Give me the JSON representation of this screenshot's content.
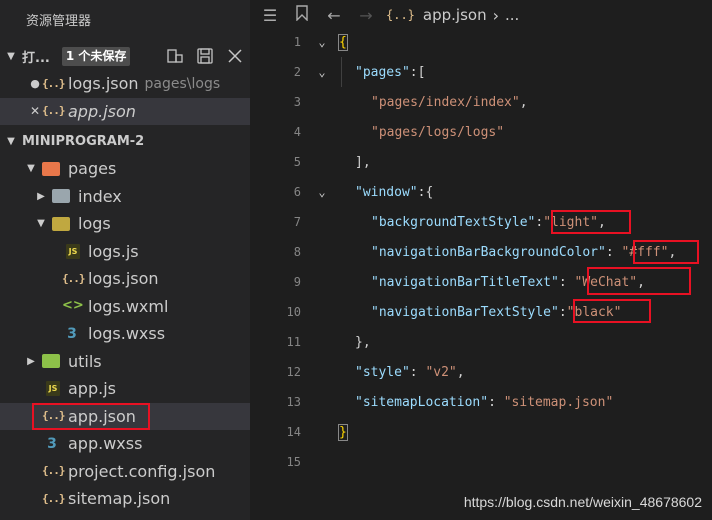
{
  "sidebar": {
    "title": "资源管理器",
    "open_editors": {
      "label": "打...",
      "badge": "1 个未保存",
      "files": [
        {
          "marker": "●",
          "name": "logs.json",
          "path": "pages\\logs",
          "icon": "json-icon"
        },
        {
          "marker": "✕",
          "name": "app.json",
          "path": "",
          "icon": "json-icon"
        }
      ]
    },
    "project": {
      "label": "MINIPROGRAM-2",
      "tree": [
        {
          "name": "pages",
          "type": "folder",
          "icon": "pages-folder-icon"
        },
        {
          "name": "index",
          "type": "folder",
          "icon": "folder-icon"
        },
        {
          "name": "logs",
          "type": "folder",
          "icon": "folder-icon"
        },
        {
          "name": "logs.js",
          "type": "js",
          "icon": "js-file-icon"
        },
        {
          "name": "logs.json",
          "type": "json",
          "icon": "json-icon"
        },
        {
          "name": "logs.wxml",
          "type": "wxml",
          "icon": "wxml-file-icon"
        },
        {
          "name": "logs.wxss",
          "type": "wxss",
          "icon": "wxss-file-icon"
        },
        {
          "name": "utils",
          "type": "folder",
          "icon": "utils-folder-icon"
        },
        {
          "name": "app.js",
          "type": "js",
          "icon": "js-file-icon"
        },
        {
          "name": "app.json",
          "type": "json",
          "icon": "json-icon"
        },
        {
          "name": "app.wxss",
          "type": "wxss",
          "icon": "wxss-file-icon"
        },
        {
          "name": "project.config.json",
          "type": "json",
          "icon": "json-icon"
        },
        {
          "name": "sitemap.json",
          "type": "json",
          "icon": "json-icon"
        }
      ]
    }
  },
  "editor": {
    "breadcrumb": {
      "icon": "{..}",
      "file": "app.json",
      "sep": "›",
      "more": "..."
    },
    "lines": [
      {
        "num": "1",
        "text": "{"
      },
      {
        "num": "2",
        "key": "\"pages\"",
        "rest": ":["
      },
      {
        "num": "3",
        "str": "\"pages/index/index\"",
        "rest": ","
      },
      {
        "num": "4",
        "str": "\"pages/logs/logs\"",
        "rest": ""
      },
      {
        "num": "5",
        "text": "],"
      },
      {
        "num": "6",
        "key": "\"window\"",
        "rest": ":{"
      },
      {
        "num": "7",
        "key": "\"backgroundTextStyle\"",
        "colon": ":",
        "val": "\"light\"",
        "rest": ","
      },
      {
        "num": "8",
        "key": "\"navigationBarBackgroundColor\"",
        "colon": ": ",
        "val": "\"#fff\"",
        "rest": ","
      },
      {
        "num": "9",
        "key": "\"navigationBarTitleText\"",
        "colon": ": ",
        "val": "\"WeChat\"",
        "rest": ","
      },
      {
        "num": "10",
        "key": "\"navigationBarTextStyle\"",
        "colon": ":",
        "val": "\"black\"",
        "rest": ""
      },
      {
        "num": "11",
        "text": "},"
      },
      {
        "num": "12",
        "key": "\"style\"",
        "colon": ": ",
        "val": "\"v2\"",
        "rest": ","
      },
      {
        "num": "13",
        "key": "\"sitemapLocation\"",
        "colon": ": ",
        "val": "\"sitemap.json\"",
        "rest": ""
      },
      {
        "num": "14",
        "text": "}"
      },
      {
        "num": "15",
        "text": ""
      }
    ]
  },
  "watermark": "https://blog.csdn.net/weixin_48678602",
  "colors": {
    "highlight_box": "#e81123",
    "json_key": "#9cdcfe",
    "json_string": "#ce9178",
    "bracket": "#ffd700"
  }
}
